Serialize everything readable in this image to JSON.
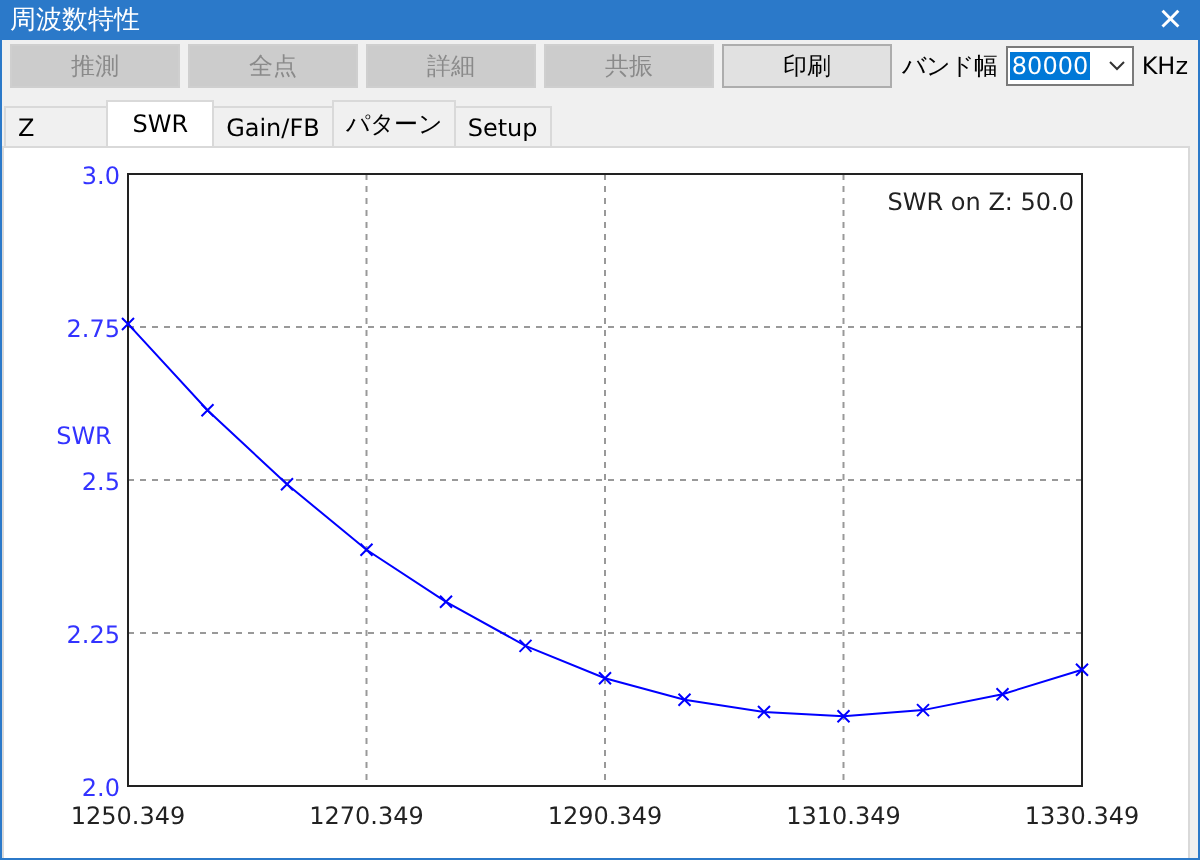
{
  "window": {
    "title": "周波数特性",
    "close": "×"
  },
  "toolbar": {
    "buttons": [
      {
        "label": "推測",
        "disabled": true
      },
      {
        "label": "全点",
        "disabled": true
      },
      {
        "label": "詳細",
        "disabled": true
      },
      {
        "label": "共振",
        "disabled": true
      },
      {
        "label": "印刷",
        "disabled": false
      }
    ],
    "band_label": "バンド幅",
    "band_value": "80000",
    "unit": "KHz"
  },
  "tabs": [
    {
      "label": "Z",
      "selected": false
    },
    {
      "label": "SWR",
      "selected": true
    },
    {
      "label": "Gain/FB",
      "selected": false
    },
    {
      "label": "パターン",
      "selected": false
    },
    {
      "label": "Setup",
      "selected": false
    }
  ],
  "chart_data": {
    "type": "line",
    "ylabel": "SWR",
    "xlim": [
      1250.349,
      1330.349
    ],
    "ylim": [
      2.0,
      3.0
    ],
    "xticks": [
      {
        "value": 1250.349,
        "label": "1250.349"
      },
      {
        "value": 1270.349,
        "label": "1270.349"
      },
      {
        "value": 1290.349,
        "label": "1290.349"
      },
      {
        "value": 1310.349,
        "label": "1310.349"
      },
      {
        "value": 1330.349,
        "label": "1330.349"
      }
    ],
    "yticks": [
      {
        "value": 2.0,
        "label": "2.0"
      },
      {
        "value": 2.25,
        "label": "2.25"
      },
      {
        "value": 2.5,
        "label": "2.5"
      },
      {
        "value": 2.75,
        "label": "2.75"
      },
      {
        "value": 3.0,
        "label": "3.0"
      }
    ],
    "x": [
      1250.349,
      1257.016,
      1263.682,
      1270.349,
      1277.016,
      1283.682,
      1290.349,
      1297.016,
      1303.682,
      1310.349,
      1317.016,
      1323.682,
      1330.349
    ],
    "grid": true,
    "series": [
      {
        "color": "#0000ff",
        "marker": "x",
        "values": [
          2.755,
          2.614,
          2.493,
          2.386,
          2.301,
          2.229,
          2.176,
          2.141,
          2.121,
          2.114,
          2.124,
          2.15,
          2.19
        ]
      }
    ],
    "annotations": [
      "SWR on Z: 50.0"
    ]
  }
}
